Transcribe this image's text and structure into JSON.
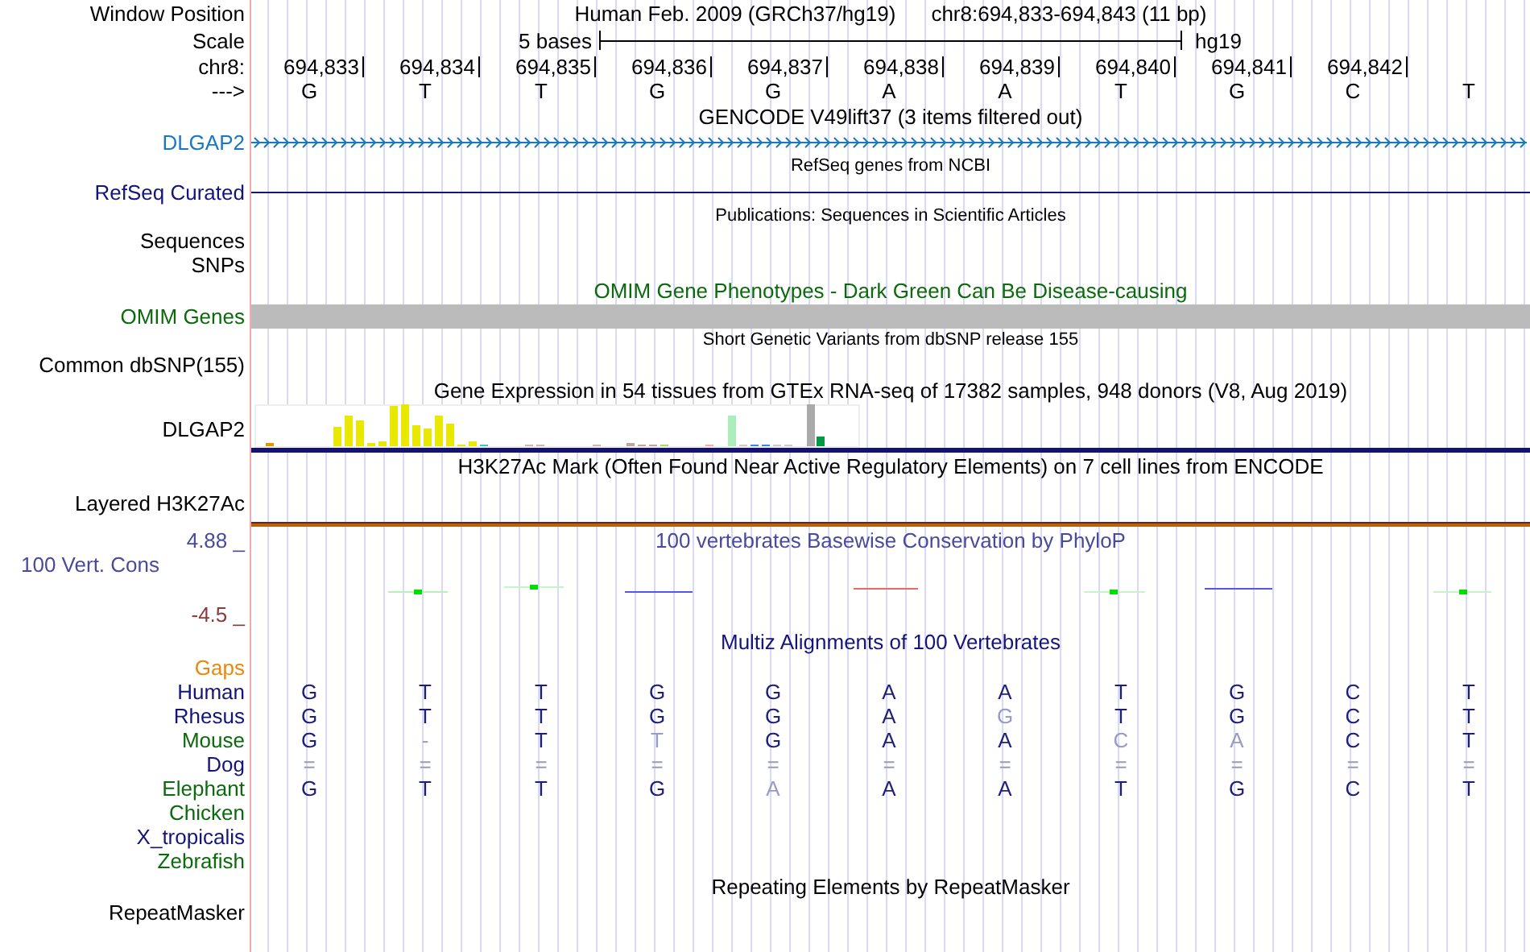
{
  "rows": [
    {
      "kind": "position",
      "label": "Window Position",
      "assembly": "Human Feb. 2009 (GRCh37/hg19)",
      "range": "chr8:694,833-694,843 (11 bp)"
    },
    {
      "kind": "scale",
      "label": "Scale",
      "span": "5 bases",
      "assembly": "hg19"
    },
    {
      "kind": "ruler",
      "label": "chr8:",
      "positions": [
        "694,833",
        "694,834",
        "694,835",
        "694,836",
        "694,837",
        "694,838",
        "694,839",
        "694,840",
        "694,841",
        "694,842"
      ]
    },
    {
      "kind": "sequence",
      "label": "--->",
      "bases": [
        "G",
        "T",
        "T",
        "G",
        "G",
        "A",
        "A",
        "T",
        "G",
        "C",
        "T"
      ]
    },
    {
      "kind": "title",
      "title": "GENCODE V49lift37 (3 items filtered out)",
      "color": "#000000"
    },
    {
      "kind": "gene",
      "label": "DLGAP2",
      "color": "#1a78c2"
    },
    {
      "kind": "title-small",
      "title": "RefSeq genes from NCBI",
      "color": "#000000"
    },
    {
      "kind": "line",
      "label": "RefSeq Curated",
      "color": "#14147a"
    },
    {
      "kind": "title-small",
      "title": "Publications: Sequences in Scientific Articles",
      "color": "#000000"
    },
    {
      "kind": "label",
      "label": "Sequences",
      "color": "#000000"
    },
    {
      "kind": "label",
      "label": "SNPs",
      "color": "#000000"
    },
    {
      "kind": "title",
      "title": "OMIM Gene Phenotypes - Dark Green Can Be Disease-causing",
      "color": "#0b6a0b"
    },
    {
      "kind": "bar",
      "label": "OMIM Genes",
      "color": "#0b6a0b"
    },
    {
      "kind": "title-small",
      "title": "Short Genetic Variants from dbSNP release 155",
      "color": "#000000"
    },
    {
      "kind": "label",
      "label": "Common dbSNP(155)",
      "color": "#000000"
    },
    {
      "kind": "title",
      "title": "Gene Expression in 54 tissues from GTEx RNA-seq of 17382 samples, 948 donors (V8, Aug 2019)",
      "color": "#000000"
    },
    {
      "kind": "expression",
      "label": "DLGAP2",
      "color": "#000000"
    },
    {
      "kind": "title",
      "title": "H3K27Ac Mark (Often Found Near Active Regulatory Elements) on 7 cell lines from ENCODE",
      "color": "#000000"
    },
    {
      "kind": "band",
      "label": "Layered H3K27Ac",
      "color": "#000000"
    },
    {
      "kind": "conservation",
      "title": "100 vertebrates Basewise Conservation by PhyloP",
      "max": "4.88 _",
      "label": "100 Vert. Cons",
      "min": "-4.5 _",
      "color": "#4a4a9c"
    },
    {
      "kind": "title",
      "title": "Multiz Alignments of 100 Vertebrates",
      "color": "#14147a"
    },
    {
      "kind": "label",
      "label": "Gaps",
      "color": "#e8890c"
    },
    {
      "kind": "species",
      "label": "Human",
      "color": "#14147a",
      "bases": [
        {
          "base": "G",
          "faded": false
        },
        {
          "base": "T",
          "faded": false
        },
        {
          "base": "T",
          "faded": false
        },
        {
          "base": "G",
          "faded": false
        },
        {
          "base": "G",
          "faded": false
        },
        {
          "base": "A",
          "faded": false
        },
        {
          "base": "A",
          "faded": false
        },
        {
          "base": "T",
          "faded": false
        },
        {
          "base": "G",
          "faded": false
        },
        {
          "base": "C",
          "faded": false
        },
        {
          "base": "T",
          "faded": false
        }
      ]
    },
    {
      "kind": "species",
      "label": "Rhesus",
      "color": "#14147a",
      "bases": [
        {
          "base": "G",
          "faded": false
        },
        {
          "base": "T",
          "faded": false
        },
        {
          "base": "T",
          "faded": false
        },
        {
          "base": "G",
          "faded": false
        },
        {
          "base": "G",
          "faded": false
        },
        {
          "base": "A",
          "faded": false
        },
        {
          "base": "G",
          "faded": true
        },
        {
          "base": "T",
          "faded": false
        },
        {
          "base": "G",
          "faded": false
        },
        {
          "base": "C",
          "faded": false
        },
        {
          "base": "T",
          "faded": false
        }
      ]
    },
    {
      "kind": "species",
      "label": "Mouse",
      "color": "#0b6a0b",
      "bases": [
        {
          "base": "G",
          "faded": false
        },
        {
          "base": "-",
          "faded": true
        },
        {
          "base": "T",
          "faded": false
        },
        {
          "base": "T",
          "faded": true
        },
        {
          "base": "G",
          "faded": false
        },
        {
          "base": "A",
          "faded": false
        },
        {
          "base": "A",
          "faded": false
        },
        {
          "base": "C",
          "faded": true
        },
        {
          "base": "A",
          "faded": true
        },
        {
          "base": "C",
          "faded": false
        },
        {
          "base": "T",
          "faded": false
        }
      ]
    },
    {
      "kind": "species",
      "label": "Dog",
      "color": "#14147a",
      "bases": [
        {
          "base": "=",
          "faded": true
        },
        {
          "base": "=",
          "faded": true
        },
        {
          "base": "=",
          "faded": true
        },
        {
          "base": "=",
          "faded": true
        },
        {
          "base": "=",
          "faded": true
        },
        {
          "base": "=",
          "faded": true
        },
        {
          "base": "=",
          "faded": true
        },
        {
          "base": "=",
          "faded": true
        },
        {
          "base": "=",
          "faded": true
        },
        {
          "base": "=",
          "faded": true
        },
        {
          "base": "=",
          "faded": true
        }
      ]
    },
    {
      "kind": "species",
      "label": "Elephant",
      "color": "#0b6a0b",
      "bases": [
        {
          "base": "G",
          "faded": false
        },
        {
          "base": "T",
          "faded": false
        },
        {
          "base": "T",
          "faded": false
        },
        {
          "base": "G",
          "faded": false
        },
        {
          "base": "A",
          "faded": true
        },
        {
          "base": "A",
          "faded": false
        },
        {
          "base": "A",
          "faded": false
        },
        {
          "base": "T",
          "faded": false
        },
        {
          "base": "G",
          "faded": false
        },
        {
          "base": "C",
          "faded": false
        },
        {
          "base": "T",
          "faded": false
        }
      ]
    },
    {
      "kind": "species",
      "label": "Chicken",
      "color": "#0b6a0b"
    },
    {
      "kind": "species",
      "label": "X_tropicalis",
      "color": "#14147a"
    },
    {
      "kind": "species",
      "label": "Zebrafish",
      "color": "#0b6a0b"
    },
    {
      "kind": "title",
      "title": "Repeating Elements by RepeatMasker",
      "color": "#000000"
    },
    {
      "kind": "label",
      "label": "RepeatMasker",
      "color": "#000000"
    }
  ]
}
